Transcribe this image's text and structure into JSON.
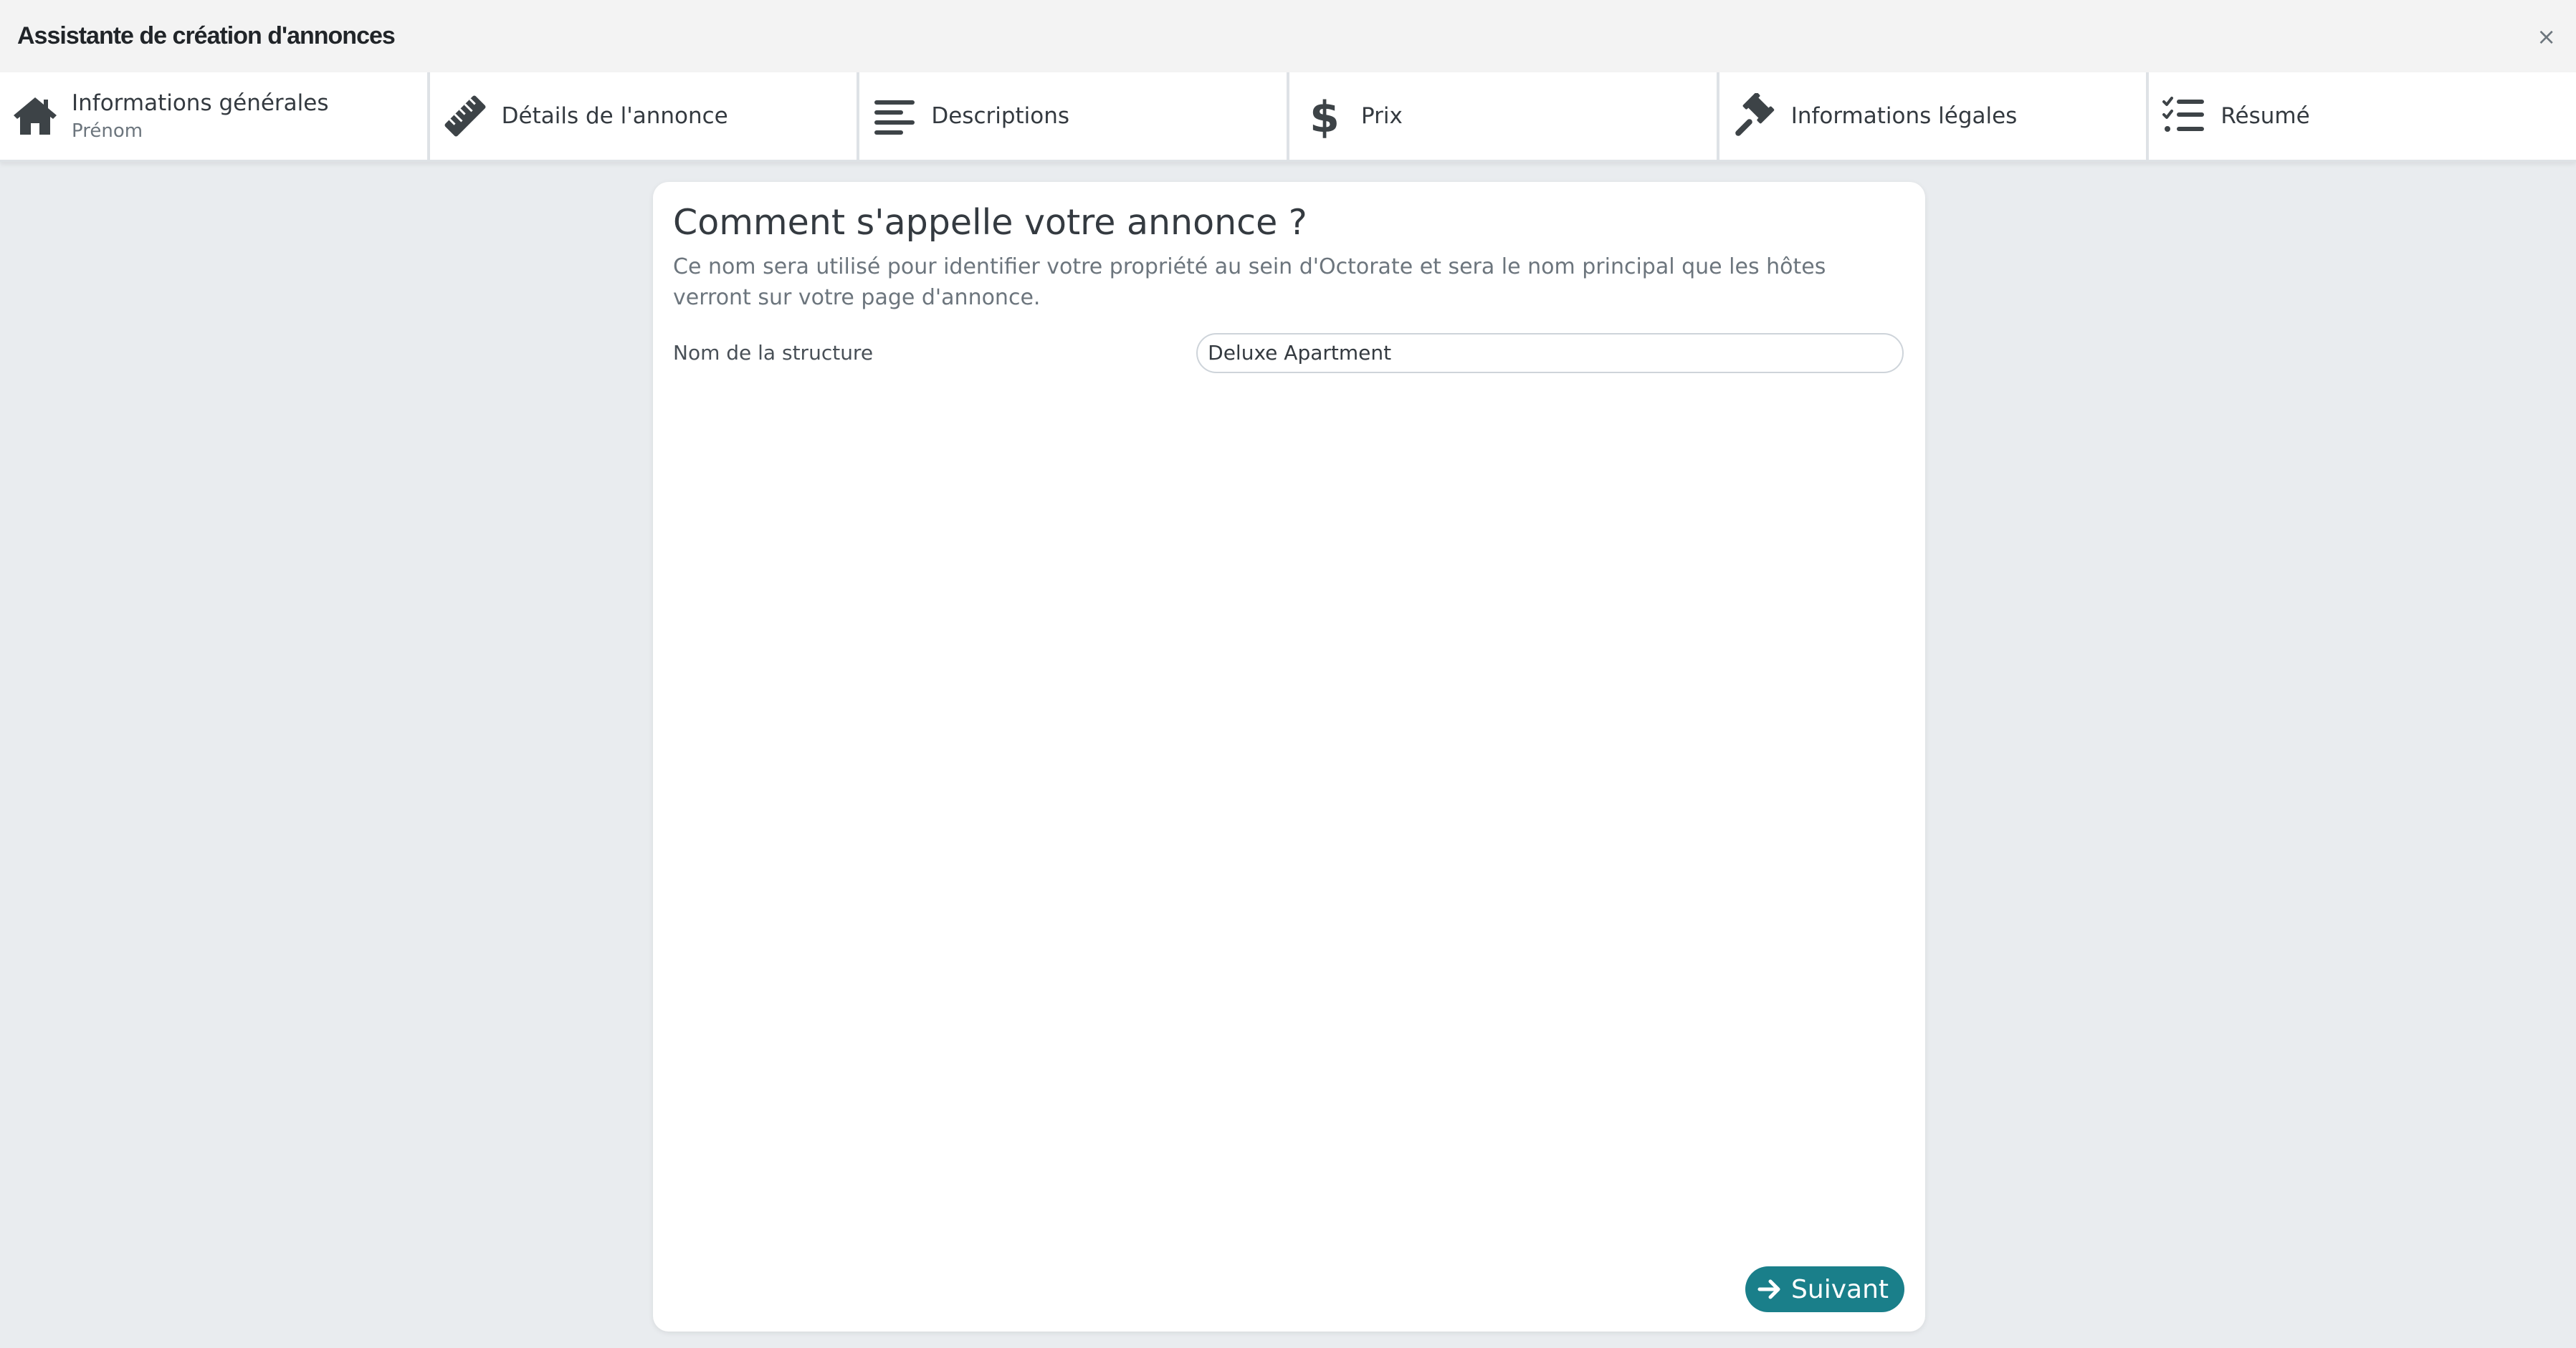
{
  "window": {
    "title": "Assistante de création d'annonces",
    "close_glyph": "×"
  },
  "steps": [
    {
      "icon": "home-icon",
      "label": "Informations générales",
      "sub": "Prénom"
    },
    {
      "icon": "ruler-icon",
      "label": "Détails de l'annonce"
    },
    {
      "icon": "align-left-icon",
      "label": "Descriptions"
    },
    {
      "icon": "dollar-icon",
      "label": "Prix"
    },
    {
      "icon": "gavel-icon",
      "label": "Informations légales"
    },
    {
      "icon": "checklist-icon",
      "label": "Résumé"
    }
  ],
  "main": {
    "heading": "Comment s'appelle votre annonce ?",
    "description": "Ce nom sera utilisé pour identifier votre propriété au sein d'Octorate et sera le nom principal que les hôtes verront sur votre page d'annonce.",
    "field": {
      "label": "Nom de la structure",
      "value": "Deluxe Apartment"
    },
    "next_label": "Suivant"
  },
  "colors": {
    "accent": "#1a7f8a",
    "background": "#e9ecef",
    "icon": "#3d4347"
  }
}
